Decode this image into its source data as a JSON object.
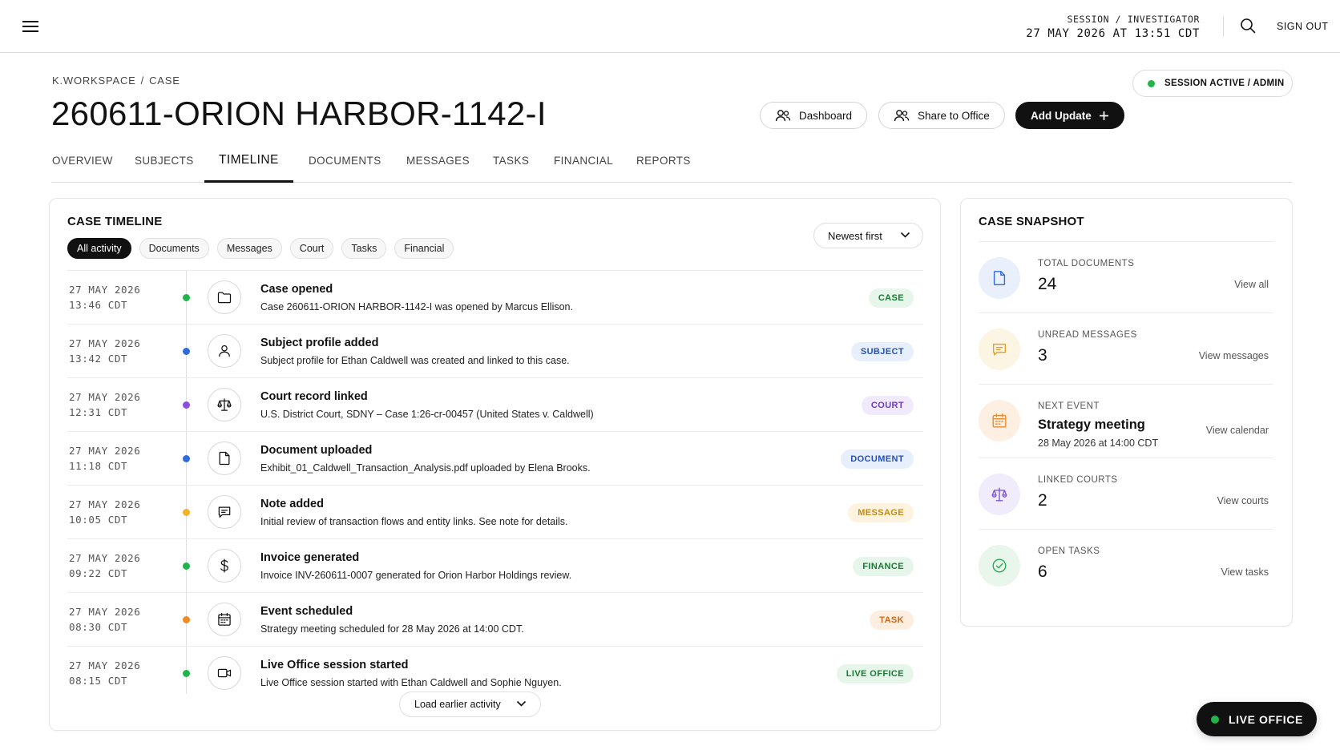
{
  "topbar": {
    "session_label": "SESSION / INVESTIGATOR",
    "session_datetime": "27 MAY 2026 AT 13:51 CDT",
    "signout_label": "SIGN OUT"
  },
  "breadcrumb": [
    "K.WORKSPACE",
    "/",
    "CASE"
  ],
  "page_title": "260611-ORION HARBOR-1142-I",
  "status_pill": "SESSION ACTIVE / ADMIN",
  "header_buttons": {
    "dashboard": "Dashboard",
    "share": "Share to Office",
    "add_update": "Add Update"
  },
  "tabs": [
    "OVERVIEW",
    "SUBJECTS",
    "TIMELINE",
    "DOCUMENTS",
    "MESSAGES",
    "TASKS",
    "FINANCIAL",
    "REPORTS"
  ],
  "active_tab": "TIMELINE",
  "timeline": {
    "title": "CASE TIMELINE",
    "filters": [
      "All activity",
      "Documents",
      "Messages",
      "Court",
      "Tasks",
      "Financial"
    ],
    "sort_label": "Newest first",
    "load_more": "Load earlier activity",
    "events": [
      {
        "date": "27 MAY 2026",
        "time": "13:46 CDT",
        "title": "Case opened",
        "desc": "Case 260611-ORION HARBOR-1142-I was opened by Marcus Ellison.",
        "badge": "CASE",
        "icon": "folder-icon",
        "dot": "#22b34a",
        "badge_bg": "#e6f6ea",
        "badge_fg": "#1a7a35"
      },
      {
        "date": "27 MAY 2026",
        "time": "13:42 CDT",
        "title": "Subject profile added",
        "desc": "Subject profile for Ethan Caldwell was created and linked to this case.",
        "badge": "SUBJECT",
        "icon": "user-icon",
        "dot": "#2f6bdc",
        "badge_bg": "#e8effc",
        "badge_fg": "#2452b5"
      },
      {
        "date": "27 MAY 2026",
        "time": "12:31 CDT",
        "title": "Court record linked",
        "desc": "U.S. District Court, SDNY – Case 1:26-cr-00457 (United States v. Caldwell)",
        "badge": "COURT",
        "icon": "scales-icon",
        "dot": "#8b4fe0",
        "badge_bg": "#f1eafc",
        "badge_fg": "#6b3dbf"
      },
      {
        "date": "27 MAY 2026",
        "time": "11:18 CDT",
        "title": "Document uploaded",
        "desc": "Exhibit_01_Caldwell_Transaction_Analysis.pdf uploaded by Elena Brooks.",
        "badge": "DOCUMENT",
        "icon": "document-icon",
        "dot": "#2f6bdc",
        "badge_bg": "#e8effc",
        "badge_fg": "#2452b5"
      },
      {
        "date": "27 MAY 2026",
        "time": "10:05 CDT",
        "title": "Note added",
        "desc": "Initial review of transaction flows and entity links. See note for details.",
        "badge": "MESSAGE",
        "icon": "message-icon",
        "dot": "#f0b429",
        "badge_bg": "#fdf3de",
        "badge_fg": "#c58a12"
      },
      {
        "date": "27 MAY 2026",
        "time": "09:22 CDT",
        "title": "Invoice generated",
        "desc": "Invoice INV-260611-0007 generated for Orion Harbor Holdings review.",
        "badge": "FINANCE",
        "icon": "dollar-icon",
        "dot": "#22b34a",
        "badge_bg": "#e6f6ea",
        "badge_fg": "#1a7a35"
      },
      {
        "date": "27 MAY 2026",
        "time": "08:30 CDT",
        "title": "Event scheduled",
        "desc": "Strategy meeting scheduled for 28 May 2026 at 14:00 CDT.",
        "badge": "TASK",
        "icon": "calendar-icon",
        "dot": "#f08a24",
        "badge_bg": "#fdeee0",
        "badge_fg": "#d0651a"
      },
      {
        "date": "27 MAY 2026",
        "time": "08:15 CDT",
        "title": "Live Office session started",
        "desc": "Live Office session started with Ethan Caldwell and Sophie Nguyen.",
        "badge": "LIVE OFFICE",
        "icon": "video-icon",
        "dot": "#22b34a",
        "badge_bg": "#e6f6ea",
        "badge_fg": "#1a7a35"
      }
    ]
  },
  "snapshot": {
    "title": "CASE SNAPSHOT",
    "items": [
      {
        "label": "TOTAL DOCUMENTS",
        "value": "24",
        "link": "View all",
        "icon": "document-icon",
        "tint": "#e9effb",
        "color": "#2f6bdc"
      },
      {
        "label": "UNREAD MESSAGES",
        "value": "3",
        "link": "View messages",
        "icon": "message-icon",
        "tint": "#fdf5e3",
        "color": "#e0a226"
      },
      {
        "label": "NEXT EVENT",
        "value": "Strategy meeting",
        "sub": "28 May 2026 at 14:00 CDT",
        "link": "View calendar",
        "icon": "calendar-icon",
        "tint": "#fdf0e3",
        "color": "#ec8a2e"
      },
      {
        "label": "LINKED COURTS",
        "value": "2",
        "link": "View courts",
        "icon": "scales-icon",
        "tint": "#f1ecfb",
        "color": "#7d55d6"
      },
      {
        "label": "OPEN TASKS",
        "value": "6",
        "link": "View tasks",
        "icon": "check-icon",
        "tint": "#e8f6ec",
        "color": "#2aa852"
      }
    ]
  },
  "live_office_label": "LIVE OFFICE"
}
